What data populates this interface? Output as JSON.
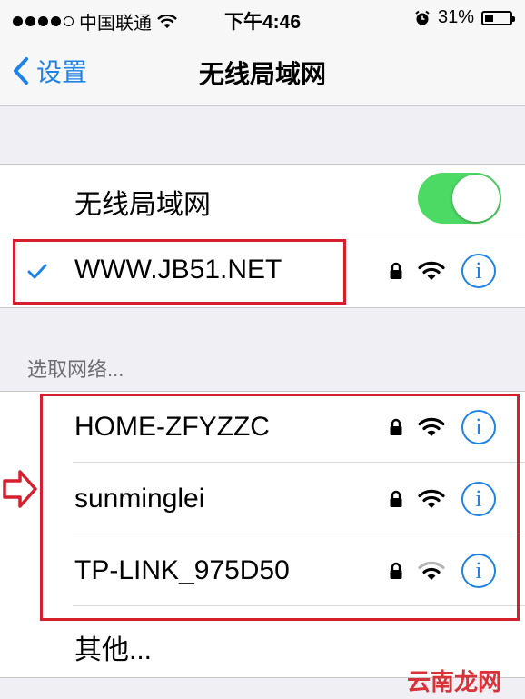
{
  "status_bar": {
    "carrier": "中国联通",
    "time": "下午4:46",
    "battery_percent": "31%",
    "signal_dots_filled": 4,
    "signal_dots_total": 5,
    "icons": [
      "signal-dots-icon",
      "wifi-icon",
      "alarm-clock-icon",
      "battery-icon"
    ]
  },
  "nav": {
    "back_label": "设置",
    "title": "无线局域网"
  },
  "wifi_toggle": {
    "label": "无线局域网",
    "state": "on",
    "on_color": "#4cd964"
  },
  "connected_network": {
    "name": "WWW.JB51.NET",
    "checked": true,
    "secured": true,
    "info_label": "i"
  },
  "choose_network": {
    "header": "选取网络...",
    "networks": [
      {
        "name": "HOME-ZFYZZC",
        "secured": true,
        "signal": 3,
        "info_label": "i"
      },
      {
        "name": "sunminglei",
        "secured": true,
        "signal": 3,
        "info_label": "i"
      },
      {
        "name": "TP-LINK_975D50",
        "secured": true,
        "signal": 2,
        "info_label": "i"
      }
    ],
    "other_label": "其他..."
  },
  "watermark": "云南龙网",
  "colors": {
    "accent": "#1e82e6",
    "highlight_box": "#d61f2c",
    "background": "#efeff4"
  }
}
